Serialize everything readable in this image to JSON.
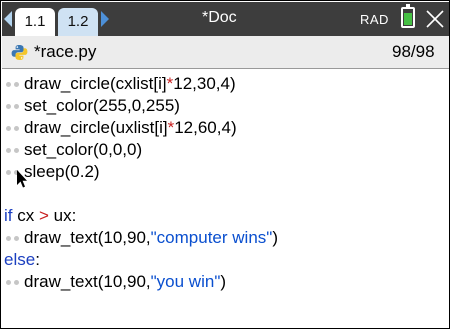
{
  "tabs": [
    {
      "label": "1.1"
    },
    {
      "label": "1.2"
    }
  ],
  "document": {
    "title": "*Doc"
  },
  "status": {
    "mode": "RAD",
    "battery_level": 0.7
  },
  "editor": {
    "file_name": "*race.py",
    "line_position": "98/98",
    "lines": [
      {
        "indent": 1,
        "segments": [
          {
            "t": "draw_circle(cxlist[i]",
            "c": "plain"
          },
          {
            "t": "*",
            "c": "op"
          },
          {
            "t": "12,30,4)",
            "c": "plain"
          }
        ]
      },
      {
        "indent": 1,
        "segments": [
          {
            "t": "set_color(255,0,255)",
            "c": "plain"
          }
        ]
      },
      {
        "indent": 1,
        "segments": [
          {
            "t": "draw_circle(uxlist[i]",
            "c": "plain"
          },
          {
            "t": "*",
            "c": "op"
          },
          {
            "t": "12,60,4)",
            "c": "plain"
          }
        ]
      },
      {
        "indent": 1,
        "segments": [
          {
            "t": "set_color(0,0,0)",
            "c": "plain"
          }
        ]
      },
      {
        "indent": 1,
        "segments": [
          {
            "t": "sleep(0.2)",
            "c": "plain"
          }
        ]
      },
      {
        "indent": 0,
        "segments": []
      },
      {
        "indent": 0,
        "segments": [
          {
            "t": "if",
            "c": "kw"
          },
          {
            "t": " cx ",
            "c": "plain"
          },
          {
            "t": ">",
            "c": "op"
          },
          {
            "t": " ux:",
            "c": "plain"
          }
        ]
      },
      {
        "indent": 1,
        "segments": [
          {
            "t": "draw_text(10,90,",
            "c": "plain"
          },
          {
            "t": "\"computer wins\"",
            "c": "str"
          },
          {
            "t": ")",
            "c": "plain"
          }
        ]
      },
      {
        "indent": 0,
        "segments": [
          {
            "t": "else",
            "c": "kw"
          },
          {
            "t": ":",
            "c": "plain"
          }
        ]
      },
      {
        "indent": 1,
        "segments": [
          {
            "t": "draw_text(10,90,",
            "c": "plain"
          },
          {
            "t": "\"you win\"",
            "c": "str"
          },
          {
            "t": ")",
            "c": "plain"
          }
        ]
      }
    ]
  }
}
